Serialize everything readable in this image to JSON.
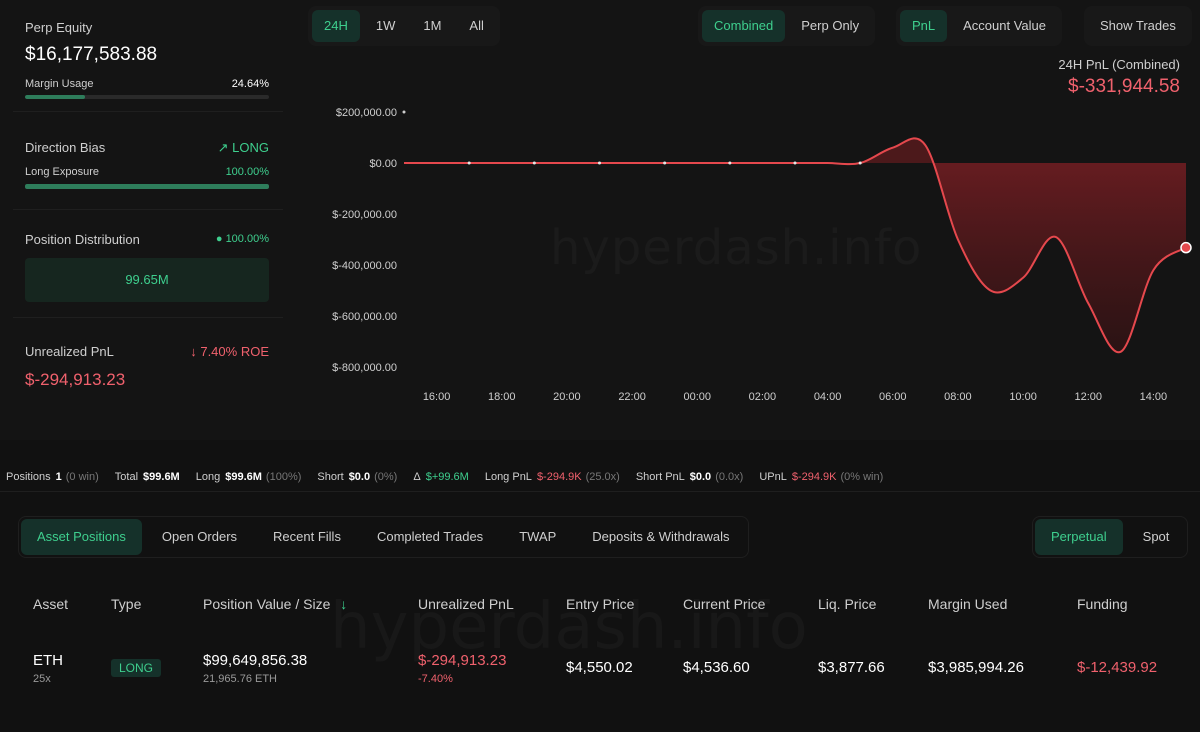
{
  "left": {
    "perp_equity_label": "Perp Equity",
    "perp_equity_value": "$16,177,583.88",
    "margin_usage_label": "Margin Usage",
    "margin_usage_value": "24.64%",
    "margin_usage_fraction": 0.2464,
    "direction_bias_label": "Direction Bias",
    "direction_bias_value": "LONG",
    "long_exposure_label": "Long Exposure",
    "long_exposure_value": "100.00%",
    "long_exposure_fraction": 1.0,
    "position_distribution_label": "Position Distribution",
    "position_distribution_value": "100.00%",
    "position_distribution_bar": "99.65M",
    "unrealized_label": "Unrealized PnL",
    "unrealized_roe": "7.40% ROE",
    "unrealized_value": "$-294,913.23"
  },
  "range_tabs": [
    "24H",
    "1W",
    "1M",
    "All"
  ],
  "range_selected": "24H",
  "mode_tabs": [
    "Combined",
    "Perp Only"
  ],
  "mode_selected": "Combined",
  "metric_tabs": [
    "PnL",
    "Account Value"
  ],
  "metric_selected": "PnL",
  "show_trades_label": "Show Trades",
  "summary": {
    "title": "24H PnL (Combined)",
    "value": "$-331,944.58"
  },
  "watermark": "hyperdash.info",
  "colors": {
    "accent_green": "#3ecf8e",
    "negative_red": "#f0616d",
    "line_red": "#e5484d"
  },
  "chart_data": {
    "type": "area",
    "x": [
      "15:00",
      "16:00",
      "17:00",
      "18:00",
      "19:00",
      "20:00",
      "21:00",
      "22:00",
      "23:00",
      "00:00",
      "01:00",
      "02:00",
      "03:00",
      "04:00",
      "05:00",
      "06:00",
      "07:00",
      "08:00",
      "09:00",
      "10:00",
      "11:00",
      "12:00",
      "13:00",
      "14:00",
      "15:00"
    ],
    "y_approx": [
      0,
      0,
      0,
      0,
      0,
      0,
      0,
      0,
      0,
      0,
      0,
      0,
      0,
      0,
      0,
      60000,
      70000,
      -300000,
      -500000,
      -450000,
      -290000,
      -550000,
      -740000,
      -420000,
      -331944.58
    ],
    "xticks": [
      "16:00",
      "18:00",
      "20:00",
      "22:00",
      "00:00",
      "02:00",
      "04:00",
      "06:00",
      "08:00",
      "10:00",
      "12:00",
      "14:00"
    ],
    "yticks": [
      "$200,000.00",
      "$0.00",
      "$-200,000.00",
      "$-400,000.00",
      "$-600,000.00",
      "$-800,000.00"
    ],
    "ylim": [
      -800000,
      200000
    ]
  },
  "stats": [
    {
      "label": "Positions",
      "value": "1",
      "muted": "(0 win)"
    },
    {
      "label": "Total",
      "value": "$99.6M",
      "muted": ""
    },
    {
      "label": "Long",
      "value": "$99.6M",
      "muted": "(100%)"
    },
    {
      "label": "Short",
      "value": "$0.0",
      "muted": "(0%)"
    },
    {
      "label": "Δ",
      "value": "$+99.6M",
      "muted": ""
    },
    {
      "label": "Long PnL",
      "value": "$-294.9K",
      "muted": "(25.0x)"
    },
    {
      "label": "Short PnL",
      "value": "$0.0",
      "muted": "(0.0x)"
    },
    {
      "label": "UPnL",
      "value": "$-294.9K",
      "muted": "(0% win)"
    }
  ],
  "bottom_tabs": [
    "Asset Positions",
    "Open Orders",
    "Recent Fills",
    "Completed Trades",
    "TWAP",
    "Deposits & Withdrawals"
  ],
  "bottom_selected": "Asset Positions",
  "market_tabs": [
    "Perpetual",
    "Spot"
  ],
  "market_selected": "Perpetual",
  "table": {
    "headers": [
      "Asset",
      "Type",
      "Position Value / Size",
      "Unrealized PnL",
      "Entry Price",
      "Current Price",
      "Liq. Price",
      "Margin Used",
      "Funding"
    ],
    "sort_icon": "↓",
    "rows": [
      {
        "asset": "ETH",
        "leverage": "25x",
        "type": "LONG",
        "position_value": "$99,649,856.38",
        "size": "21,965.76 ETH",
        "unrealized": "$-294,913.23",
        "unrealized_pct": "-7.40%",
        "entry": "$4,550.02",
        "current": "$4,536.60",
        "liq": "$3,877.66",
        "margin": "$3,985,994.26",
        "funding": "$-12,439.92"
      }
    ]
  }
}
